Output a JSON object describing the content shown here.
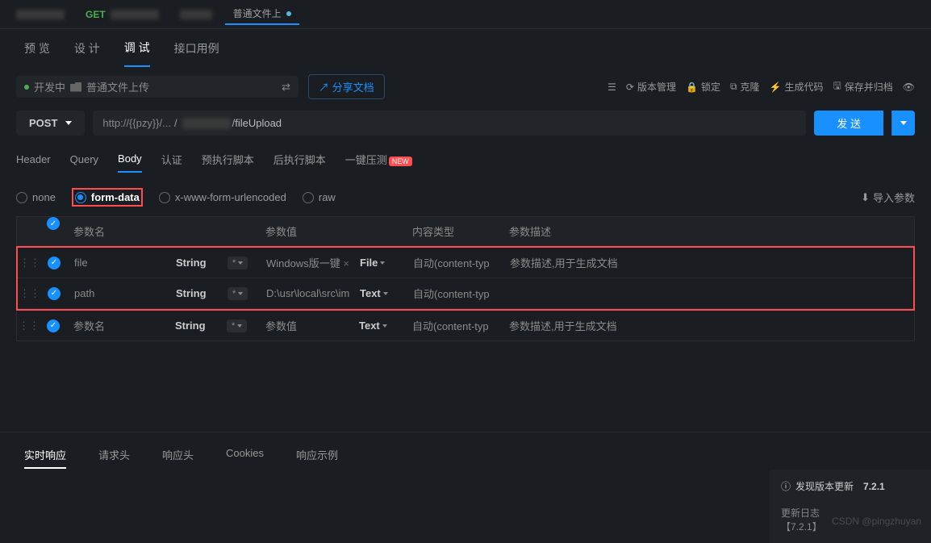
{
  "topTabs": {
    "getLabel": "GET",
    "activeLabel": "普通文件上"
  },
  "subTabs": {
    "preview": "预 览",
    "design": "设 计",
    "debug": "调 试",
    "interfaceCase": "接口用例"
  },
  "toolbar": {
    "status": "开发中",
    "breadcrumb": "普通文件上传",
    "share": "分享文档",
    "versionMgmt": "版本管理",
    "lock": "锁定",
    "clone": "克隆",
    "genCode": "生成代码",
    "saveArchive": "保存并归档"
  },
  "request": {
    "method": "POST",
    "urlPrefix": "http://{{pzy}}/...",
    "urlPath": "/fileUpload",
    "sendLabel": "发 送"
  },
  "reqTabs": {
    "header": "Header",
    "query": "Query",
    "body": "Body",
    "auth": "认证",
    "preScript": "预执行脚本",
    "postScript": "后执行脚本",
    "loadTest": "一键压测",
    "newBadge": "NEW"
  },
  "bodyTypes": {
    "none": "none",
    "formData": "form-data",
    "urlencoded": "x-www-form-urlencoded",
    "raw": "raw",
    "importParams": "导入参数"
  },
  "table": {
    "headers": {
      "name": "参数名",
      "value": "参数值",
      "contentType": "内容类型",
      "desc": "参数描述"
    },
    "rows": [
      {
        "name": "file",
        "type": "String",
        "req": "*",
        "value": "Windows版一键",
        "vtype": "File",
        "contentType": "自动(content-typ",
        "desc": "参数描述,用于生成文档"
      },
      {
        "name": "path",
        "type": "String",
        "req": "*",
        "value": "D:\\usr\\local\\src\\im",
        "vtype": "Text",
        "contentType": "自动(content-typ",
        "desc": ""
      },
      {
        "name": "参数名",
        "type": "String",
        "req": "*",
        "value": "参数值",
        "vtype": "Text",
        "contentType": "自动(content-typ",
        "desc": "参数描述,用于生成文档"
      }
    ]
  },
  "responseTabs": {
    "realtime": "实时响应",
    "reqHeaders": "请求头",
    "respHeaders": "响应头",
    "cookies": "Cookies",
    "examples": "响应示例"
  },
  "updatePanel": {
    "title": "发现版本更新",
    "version": "7.2.1",
    "changelog": "更新日志",
    "changelogVer": "【7.2.1】"
  },
  "watermark": "CSDN @pingzhuyan"
}
